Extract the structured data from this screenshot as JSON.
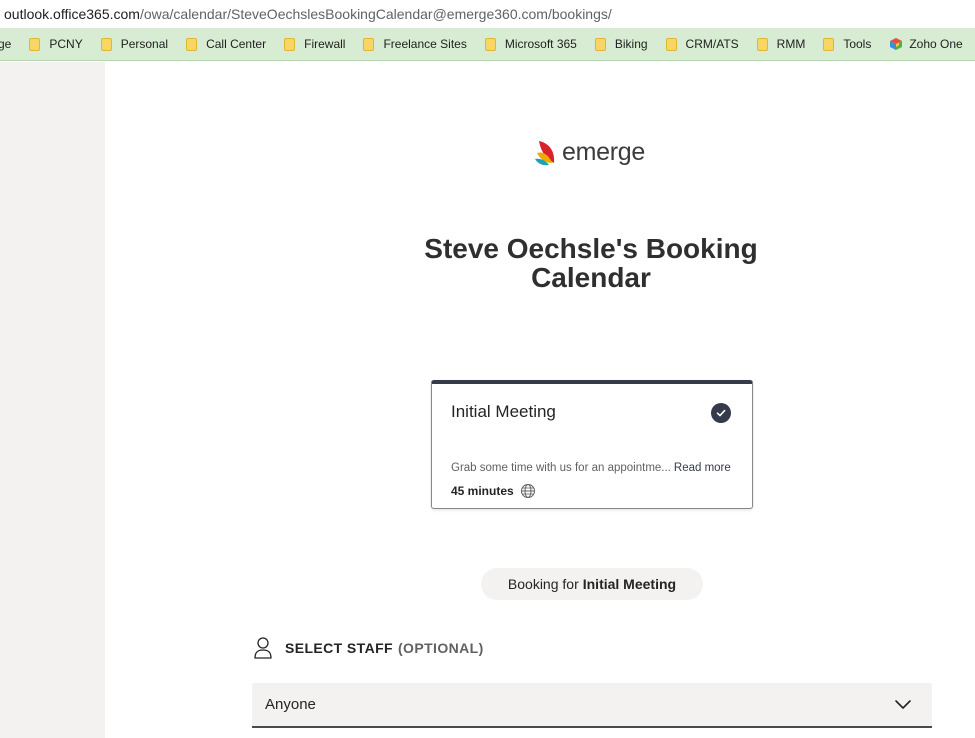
{
  "browser": {
    "url_host": "outlook.office365.com",
    "url_path": "/owa/calendar/SteveOechslesBookingCalendar@emerge360.com/bookings/"
  },
  "bookmarks": [
    {
      "label": "ge",
      "icon": "folder-icon"
    },
    {
      "label": "PCNY",
      "icon": "folder-icon"
    },
    {
      "label": "Personal",
      "icon": "folder-icon"
    },
    {
      "label": "Call Center",
      "icon": "folder-icon"
    },
    {
      "label": "Firewall",
      "icon": "folder-icon"
    },
    {
      "label": "Freelance Sites",
      "icon": "folder-icon"
    },
    {
      "label": "Microsoft 365",
      "icon": "folder-icon"
    },
    {
      "label": "Biking",
      "icon": "folder-icon"
    },
    {
      "label": "CRM/ATS",
      "icon": "folder-icon"
    },
    {
      "label": "RMM",
      "icon": "folder-icon"
    },
    {
      "label": "Tools",
      "icon": "folder-icon"
    },
    {
      "label": "Zoho One",
      "icon": "zoho-icon"
    }
  ],
  "page": {
    "logo_text": "emerge",
    "title": "Steve Oechsle's Booking Calendar"
  },
  "service": {
    "name": "Initial Meeting",
    "description": "Grab some time with us for an appointme...",
    "read_more": "Read more",
    "duration": "45 minutes"
  },
  "booking_for": {
    "prefix": "Booking for",
    "service": "Initial Meeting"
  },
  "staff": {
    "title": "SELECT STAFF",
    "optional": "(OPTIONAL)",
    "selected": "Anyone"
  },
  "colors": {
    "bookmark_bar": "#d7ecd3",
    "accent": "#363b4c",
    "left_pane": "#f3f2f1"
  }
}
